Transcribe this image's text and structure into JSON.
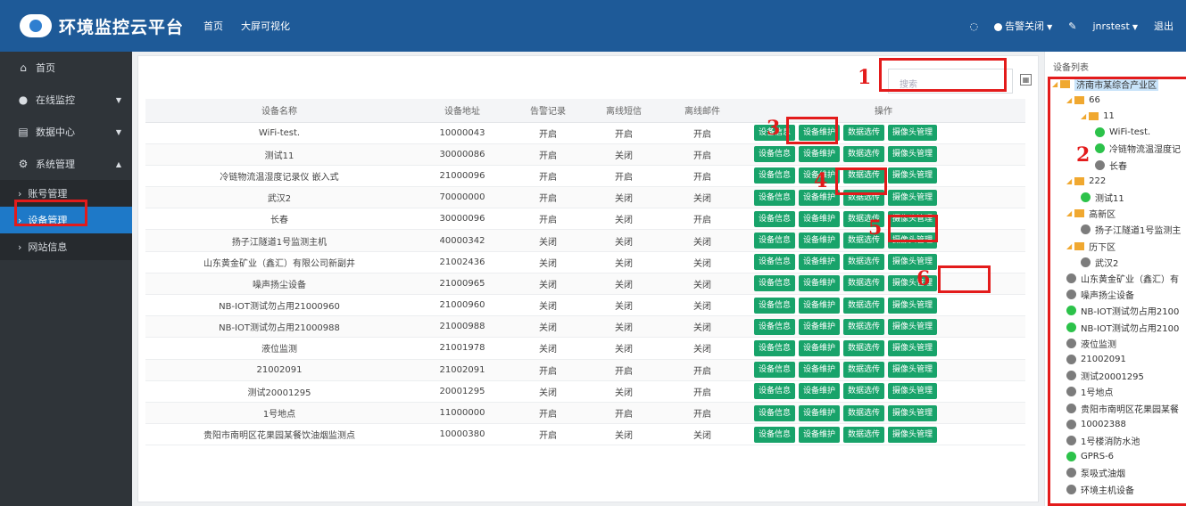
{
  "header": {
    "app_title": "环境监控云平台",
    "nav": [
      "首页",
      "大屏可视化"
    ],
    "alarm_label": "告警关闭",
    "user": "jnrstest",
    "logout": "退出"
  },
  "sidebar": {
    "items": [
      {
        "label": "首页",
        "icon": "home-icon"
      },
      {
        "label": "在线监控",
        "icon": "globe-icon"
      },
      {
        "label": "数据中心",
        "icon": "calendar-icon"
      },
      {
        "label": "系统管理",
        "icon": "gear-icon"
      }
    ],
    "sub_items": [
      "账号管理",
      "设备管理",
      "网站信息"
    ]
  },
  "search": {
    "placeholder": "搜索"
  },
  "table": {
    "headers": [
      "设备名称",
      "设备地址",
      "告警记录",
      "离线短信",
      "离线邮件",
      "操作"
    ],
    "action_labels": [
      "设备信息",
      "设备维护",
      "数据选传",
      "摄像头管理"
    ],
    "rows": [
      [
        "WiFi-test.",
        "10000043",
        "开启",
        "开启",
        "开启"
      ],
      [
        "测试11",
        "30000086",
        "开启",
        "关闭",
        "开启"
      ],
      [
        "冷链物流温湿度记录仪 嵌入式",
        "21000096",
        "开启",
        "开启",
        "开启"
      ],
      [
        "武汉2",
        "70000000",
        "开启",
        "关闭",
        "关闭"
      ],
      [
        "长春",
        "30000096",
        "开启",
        "关闭",
        "开启"
      ],
      [
        "扬子江隧道1号监测主机",
        "40000342",
        "关闭",
        "关闭",
        "关闭"
      ],
      [
        "山东黄金矿业（鑫汇）有限公司新副井",
        "21002436",
        "关闭",
        "关闭",
        "关闭"
      ],
      [
        "噪声扬尘设备",
        "21000965",
        "关闭",
        "关闭",
        "关闭"
      ],
      [
        "NB-IOT测试勿占用21000960",
        "21000960",
        "关闭",
        "关闭",
        "关闭"
      ],
      [
        "NB-IOT测试勿占用21000988",
        "21000988",
        "关闭",
        "关闭",
        "关闭"
      ],
      [
        "液位监测",
        "21001978",
        "关闭",
        "关闭",
        "关闭"
      ],
      [
        "21002091",
        "21002091",
        "开启",
        "开启",
        "开启"
      ],
      [
        "测试20001295",
        "20001295",
        "关闭",
        "关闭",
        "开启"
      ],
      [
        "1号地点",
        "11000000",
        "开启",
        "开启",
        "开启"
      ],
      [
        "贵阳市南明区花果园某餐饮油烟监测点",
        "10000380",
        "开启",
        "关闭",
        "关闭"
      ]
    ]
  },
  "annotations": [
    "1",
    "2",
    "3",
    "4",
    "5",
    "6"
  ],
  "tree": {
    "title": "设备列表",
    "nodes": [
      {
        "label": "济南市某综合产业区",
        "kind": "folder",
        "indent": 0
      },
      {
        "label": "66",
        "kind": "folder",
        "indent": 1
      },
      {
        "label": "11",
        "kind": "folder",
        "indent": 2
      },
      {
        "label": "WiFi-test.",
        "kind": "green",
        "indent": 3
      },
      {
        "label": "冷链物流温湿度记",
        "kind": "green",
        "indent": 3
      },
      {
        "label": "长春",
        "kind": "gray",
        "indent": 3
      },
      {
        "label": "222",
        "kind": "folder",
        "indent": 1
      },
      {
        "label": "测试11",
        "kind": "green",
        "indent": 2
      },
      {
        "label": "高新区",
        "kind": "folder",
        "indent": 1
      },
      {
        "label": "扬子江隧道1号监测主",
        "kind": "gray",
        "indent": 2
      },
      {
        "label": "历下区",
        "kind": "folder",
        "indent": 1
      },
      {
        "label": "武汉2",
        "kind": "gray",
        "indent": 2
      },
      {
        "label": "山东黄金矿业（鑫汇）有",
        "kind": "gray",
        "indent": 1
      },
      {
        "label": "噪声扬尘设备",
        "kind": "gray",
        "indent": 1
      },
      {
        "label": "NB-IOT测试勿占用2100",
        "kind": "green",
        "indent": 1
      },
      {
        "label": "NB-IOT测试勿占用2100",
        "kind": "green",
        "indent": 1
      },
      {
        "label": "液位监测",
        "kind": "gray",
        "indent": 1
      },
      {
        "label": "21002091",
        "kind": "gray",
        "indent": 1
      },
      {
        "label": "测试20001295",
        "kind": "gray",
        "indent": 1
      },
      {
        "label": "1号地点",
        "kind": "gray",
        "indent": 1
      },
      {
        "label": "贵阳市南明区花果园某餐",
        "kind": "gray",
        "indent": 1
      },
      {
        "label": "10002388",
        "kind": "gray",
        "indent": 1
      },
      {
        "label": "1号楼消防水池",
        "kind": "gray",
        "indent": 1
      },
      {
        "label": "GPRS-6",
        "kind": "green",
        "indent": 1
      },
      {
        "label": "泵吸式油烟",
        "kind": "gray",
        "indent": 1
      },
      {
        "label": "环境主机设备",
        "kind": "gray",
        "indent": 1
      }
    ]
  }
}
